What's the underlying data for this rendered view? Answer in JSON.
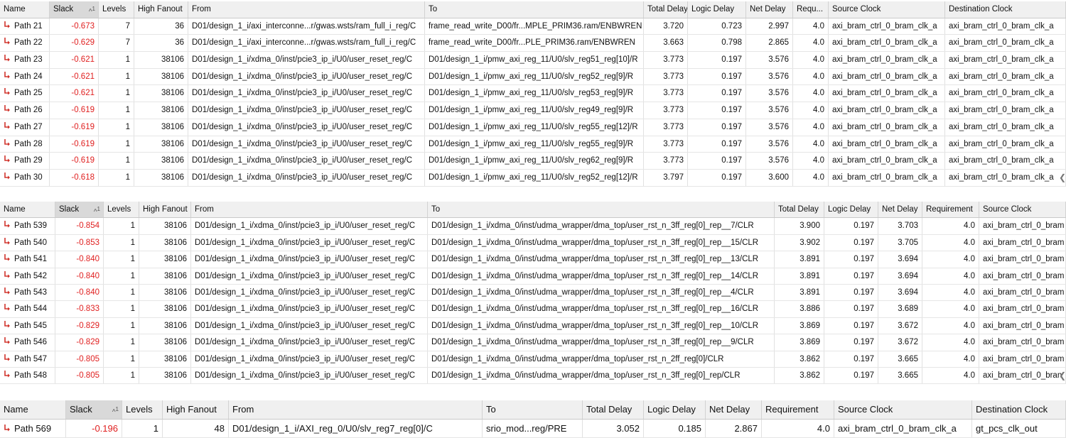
{
  "table1": {
    "headers": [
      "Name",
      "Slack",
      "Levels",
      "High Fanout",
      "From",
      "To",
      "Total Delay",
      "Logic Delay",
      "Net Delay",
      "Requ...",
      "Source Clock",
      "Destination Clock"
    ],
    "sort_indicator": "^",
    "sort_rank": "1",
    "rows": [
      [
        "Path 21",
        "-0.673",
        "7",
        "36",
        "D01/design_1_i/axi_interconne...r/gwas.wsts/ram_full_i_reg/C",
        "frame_read_write_D00/fr...MPLE_PRIM36.ram/ENBWREN",
        "3.720",
        "0.723",
        "2.997",
        "4.0",
        "axi_bram_ctrl_0_bram_clk_a",
        "axi_bram_ctrl_0_bram_clk_a"
      ],
      [
        "Path 22",
        "-0.629",
        "7",
        "36",
        "D01/design_1_i/axi_interconne...r/gwas.wsts/ram_full_i_reg/C",
        "frame_read_write_D00/fr...PLE_PRIM36.ram/ENBWREN",
        "3.663",
        "0.798",
        "2.865",
        "4.0",
        "axi_bram_ctrl_0_bram_clk_a",
        "axi_bram_ctrl_0_bram_clk_a"
      ],
      [
        "Path 23",
        "-0.621",
        "1",
        "38106",
        "D01/design_1_i/xdma_0/inst/pcie3_ip_i/U0/user_reset_reg/C",
        "D01/design_1_i/pmw_axi_reg_11/U0/slv_reg51_reg[10]/R",
        "3.773",
        "0.197",
        "3.576",
        "4.0",
        "axi_bram_ctrl_0_bram_clk_a",
        "axi_bram_ctrl_0_bram_clk_a"
      ],
      [
        "Path 24",
        "-0.621",
        "1",
        "38106",
        "D01/design_1_i/xdma_0/inst/pcie3_ip_i/U0/user_reset_reg/C",
        "D01/design_1_i/pmw_axi_reg_11/U0/slv_reg52_reg[9]/R",
        "3.773",
        "0.197",
        "3.576",
        "4.0",
        "axi_bram_ctrl_0_bram_clk_a",
        "axi_bram_ctrl_0_bram_clk_a"
      ],
      [
        "Path 25",
        "-0.621",
        "1",
        "38106",
        "D01/design_1_i/xdma_0/inst/pcie3_ip_i/U0/user_reset_reg/C",
        "D01/design_1_i/pmw_axi_reg_11/U0/slv_reg53_reg[9]/R",
        "3.773",
        "0.197",
        "3.576",
        "4.0",
        "axi_bram_ctrl_0_bram_clk_a",
        "axi_bram_ctrl_0_bram_clk_a"
      ],
      [
        "Path 26",
        "-0.619",
        "1",
        "38106",
        "D01/design_1_i/xdma_0/inst/pcie3_ip_i/U0/user_reset_reg/C",
        "D01/design_1_i/pmw_axi_reg_11/U0/slv_reg49_reg[9]/R",
        "3.773",
        "0.197",
        "3.576",
        "4.0",
        "axi_bram_ctrl_0_bram_clk_a",
        "axi_bram_ctrl_0_bram_clk_a"
      ],
      [
        "Path 27",
        "-0.619",
        "1",
        "38106",
        "D01/design_1_i/xdma_0/inst/pcie3_ip_i/U0/user_reset_reg/C",
        "D01/design_1_i/pmw_axi_reg_11/U0/slv_reg55_reg[12]/R",
        "3.773",
        "0.197",
        "3.576",
        "4.0",
        "axi_bram_ctrl_0_bram_clk_a",
        "axi_bram_ctrl_0_bram_clk_a"
      ],
      [
        "Path 28",
        "-0.619",
        "1",
        "38106",
        "D01/design_1_i/xdma_0/inst/pcie3_ip_i/U0/user_reset_reg/C",
        "D01/design_1_i/pmw_axi_reg_11/U0/slv_reg55_reg[9]/R",
        "3.773",
        "0.197",
        "3.576",
        "4.0",
        "axi_bram_ctrl_0_bram_clk_a",
        "axi_bram_ctrl_0_bram_clk_a"
      ],
      [
        "Path 29",
        "-0.619",
        "1",
        "38106",
        "D01/design_1_i/xdma_0/inst/pcie3_ip_i/U0/user_reset_reg/C",
        "D01/design_1_i/pmw_axi_reg_11/U0/slv_reg62_reg[9]/R",
        "3.773",
        "0.197",
        "3.576",
        "4.0",
        "axi_bram_ctrl_0_bram_clk_a",
        "axi_bram_ctrl_0_bram_clk_a"
      ],
      [
        "Path 30",
        "-0.618",
        "1",
        "38106",
        "D01/design_1_i/xdma_0/inst/pcie3_ip_i/U0/user_reset_reg/C",
        "D01/design_1_i/pmw_axi_reg_11/U0/slv_reg52_reg[12]/R",
        "3.797",
        "0.197",
        "3.600",
        "4.0",
        "axi_bram_ctrl_0_bram_clk_a",
        "axi_bram_ctrl_0_bram_clk_a"
      ]
    ]
  },
  "table2": {
    "headers": [
      "Name",
      "Slack",
      "Levels",
      "High Fanout",
      "From",
      "To",
      "Total Delay",
      "Logic Delay",
      "Net Delay",
      "Requirement",
      "Source Clock"
    ],
    "sort_indicator": "^",
    "sort_rank": "1",
    "rows": [
      [
        "Path 539",
        "-0.854",
        "1",
        "38106",
        "D01/design_1_i/xdma_0/inst/pcie3_ip_i/U0/user_reset_reg/C",
        "D01/design_1_i/xdma_0/inst/udma_wrapper/dma_top/user_rst_n_3ff_reg[0]_rep__7/CLR",
        "3.900",
        "0.197",
        "3.703",
        "4.0",
        "axi_bram_ctrl_0_bram"
      ],
      [
        "Path 540",
        "-0.853",
        "1",
        "38106",
        "D01/design_1_i/xdma_0/inst/pcie3_ip_i/U0/user_reset_reg/C",
        "D01/design_1_i/xdma_0/inst/udma_wrapper/dma_top/user_rst_n_3ff_reg[0]_rep__15/CLR",
        "3.902",
        "0.197",
        "3.705",
        "4.0",
        "axi_bram_ctrl_0_bram"
      ],
      [
        "Path 541",
        "-0.840",
        "1",
        "38106",
        "D01/design_1_i/xdma_0/inst/pcie3_ip_i/U0/user_reset_reg/C",
        "D01/design_1_i/xdma_0/inst/udma_wrapper/dma_top/user_rst_n_3ff_reg[0]_rep__13/CLR",
        "3.891",
        "0.197",
        "3.694",
        "4.0",
        "axi_bram_ctrl_0_bram"
      ],
      [
        "Path 542",
        "-0.840",
        "1",
        "38106",
        "D01/design_1_i/xdma_0/inst/pcie3_ip_i/U0/user_reset_reg/C",
        "D01/design_1_i/xdma_0/inst/udma_wrapper/dma_top/user_rst_n_3ff_reg[0]_rep__14/CLR",
        "3.891",
        "0.197",
        "3.694",
        "4.0",
        "axi_bram_ctrl_0_bram"
      ],
      [
        "Path 543",
        "-0.840",
        "1",
        "38106",
        "D01/design_1_i/xdma_0/inst/pcie3_ip_i/U0/user_reset_reg/C",
        "D01/design_1_i/xdma_0/inst/udma_wrapper/dma_top/user_rst_n_3ff_reg[0]_rep__4/CLR",
        "3.891",
        "0.197",
        "3.694",
        "4.0",
        "axi_bram_ctrl_0_bram"
      ],
      [
        "Path 544",
        "-0.833",
        "1",
        "38106",
        "D01/design_1_i/xdma_0/inst/pcie3_ip_i/U0/user_reset_reg/C",
        "D01/design_1_i/xdma_0/inst/udma_wrapper/dma_top/user_rst_n_3ff_reg[0]_rep__16/CLR",
        "3.886",
        "0.197",
        "3.689",
        "4.0",
        "axi_bram_ctrl_0_bram"
      ],
      [
        "Path 545",
        "-0.829",
        "1",
        "38106",
        "D01/design_1_i/xdma_0/inst/pcie3_ip_i/U0/user_reset_reg/C",
        "D01/design_1_i/xdma_0/inst/udma_wrapper/dma_top/user_rst_n_3ff_reg[0]_rep__10/CLR",
        "3.869",
        "0.197",
        "3.672",
        "4.0",
        "axi_bram_ctrl_0_bram"
      ],
      [
        "Path 546",
        "-0.829",
        "1",
        "38106",
        "D01/design_1_i/xdma_0/inst/pcie3_ip_i/U0/user_reset_reg/C",
        "D01/design_1_i/xdma_0/inst/udma_wrapper/dma_top/user_rst_n_3ff_reg[0]_rep__9/CLR",
        "3.869",
        "0.197",
        "3.672",
        "4.0",
        "axi_bram_ctrl_0_bram"
      ],
      [
        "Path 547",
        "-0.805",
        "1",
        "38106",
        "D01/design_1_i/xdma_0/inst/pcie3_ip_i/U0/user_reset_reg/C",
        "D01/design_1_i/xdma_0/inst/udma_wrapper/dma_top/user_rst_n_2ff_reg[0]/CLR",
        "3.862",
        "0.197",
        "3.665",
        "4.0",
        "axi_bram_ctrl_0_bram"
      ],
      [
        "Path 548",
        "-0.805",
        "1",
        "38106",
        "D01/design_1_i/xdma_0/inst/pcie3_ip_i/U0/user_reset_reg/C",
        "D01/design_1_i/xdma_0/inst/udma_wrapper/dma_top/user_rst_n_3ff_reg[0]_rep/CLR",
        "3.862",
        "0.197",
        "3.665",
        "4.0",
        "axi_bram_ctrl_0_bran"
      ]
    ]
  },
  "table3": {
    "headers": [
      "Name",
      "Slack",
      "Levels",
      "High Fanout",
      "From",
      "To",
      "Total Delay",
      "Logic Delay",
      "Net Delay",
      "Requirement",
      "Source Clock",
      "Destination Clock"
    ],
    "sort_indicator": "^",
    "sort_rank": "1",
    "rows": [
      [
        "Path 569",
        "-0.196",
        "1",
        "48",
        "D01/design_1_i/AXI_reg_0/U0/slv_reg7_reg[0]/C",
        "srio_mod...reg/PRE",
        "3.052",
        "0.185",
        "2.867",
        "4.0",
        "axi_bram_ctrl_0_bram_clk_a",
        "gt_pcs_clk_out"
      ]
    ]
  },
  "colors": {
    "negative_slack": "#e01f1f",
    "path_icon": "#d0342c",
    "header_bg": "#f0f0f0",
    "sorted_header_bg": "#d9d9d9"
  },
  "icons": {
    "path": "path-arrow-icon",
    "sort": "sort-ascending-icon",
    "scroll": "scroll-right-chevron-icon"
  }
}
